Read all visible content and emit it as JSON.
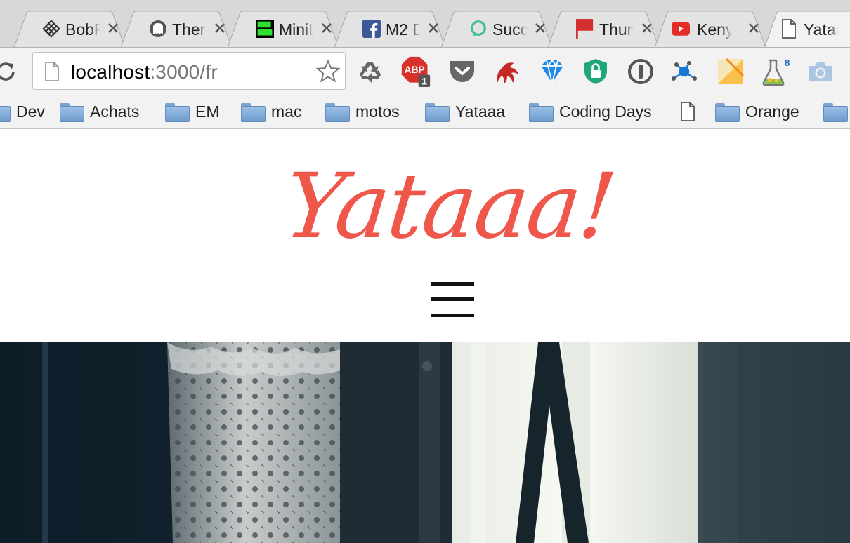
{
  "browser": {
    "tabs": [
      {
        "title": "BobF",
        "icon": "grid-diamond-icon"
      },
      {
        "title": "Ther",
        "icon": "ghost-icon"
      },
      {
        "title": "MiniL",
        "icon": "minilien-icon"
      },
      {
        "title": "M2 D",
        "icon": "facebook-icon"
      },
      {
        "title": "Succ",
        "icon": "chat-bubble-icon"
      },
      {
        "title": "Thun",
        "icon": "red-flag-icon"
      },
      {
        "title": "Keny",
        "icon": "youtube-icon"
      },
      {
        "title": "Yataa",
        "icon": "page-icon",
        "active": true
      }
    ],
    "address_bar": {
      "host": "localhost",
      "rest": ":3000/fr"
    },
    "extensions": [
      {
        "name": "recycle-icon"
      },
      {
        "name": "adblock-plus-icon",
        "label": "ABP",
        "badge": "1"
      },
      {
        "name": "pocket-icon"
      },
      {
        "name": "octopus-icon"
      },
      {
        "name": "diamond-filter-icon"
      },
      {
        "name": "lock-shield-icon"
      },
      {
        "name": "password-manager-icon"
      },
      {
        "name": "network-icon"
      },
      {
        "name": "sticky-note-icon"
      },
      {
        "name": "flask-icon"
      },
      {
        "name": "camera-icon"
      }
    ],
    "bookmarks": [
      {
        "label": "Dev",
        "icon": "folder-icon"
      },
      {
        "label": "Achats",
        "icon": "folder-icon"
      },
      {
        "label": "EM",
        "icon": "folder-icon"
      },
      {
        "label": "mac",
        "icon": "folder-icon"
      },
      {
        "label": "motos",
        "icon": "folder-icon"
      },
      {
        "label": "Yataaa",
        "icon": "folder-icon"
      },
      {
        "label": "Coding Days",
        "icon": "folder-icon"
      },
      {
        "label": "",
        "icon": "page-icon"
      },
      {
        "label": "Orange",
        "icon": "folder-icon"
      },
      {
        "label": "",
        "icon": "folder-icon"
      }
    ]
  },
  "page": {
    "logo_text": "Yataaa!",
    "brand_color": "#f0574b",
    "menu_icon": "hamburger-menu-icon"
  }
}
